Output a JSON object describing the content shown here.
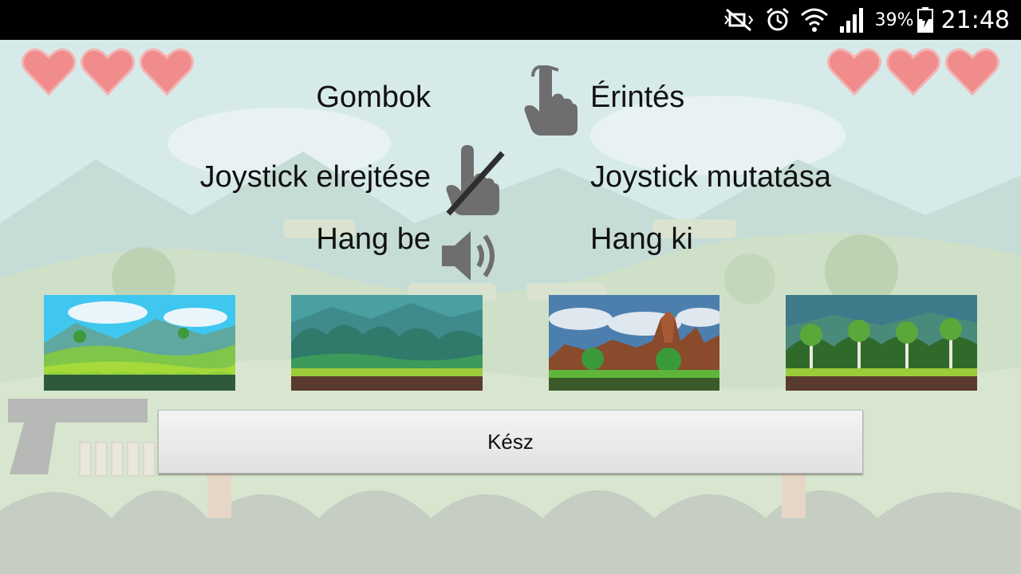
{
  "status_bar": {
    "battery_percent": "39%",
    "time": "21:48",
    "icons": [
      "mute-icon",
      "alarm-icon",
      "wifi-icon",
      "signal-icon",
      "battery-icon"
    ]
  },
  "hud": {
    "left_hearts": 3,
    "right_hearts": 3
  },
  "options": {
    "controls_left": "Gombok",
    "controls_right": "Érintés",
    "joystick_left": "Joystick elrejtése",
    "joystick_right": "Joystick mutatása",
    "sound_left": "Hang be",
    "sound_right": "Hang ki"
  },
  "backgrounds": [
    {
      "name": "background-thumb-1",
      "theme": "bright-meadow"
    },
    {
      "name": "background-thumb-2",
      "theme": "green-forest"
    },
    {
      "name": "background-thumb-3",
      "theme": "rocky-canyon"
    },
    {
      "name": "background-thumb-4",
      "theme": "birch-forest"
    }
  ],
  "done_button": "Kész",
  "colors": {
    "status_bar": "#000000",
    "heart": "#f08c8c",
    "icon_gray": "#6e6e6e",
    "button_bg": "#e8e8e8"
  }
}
